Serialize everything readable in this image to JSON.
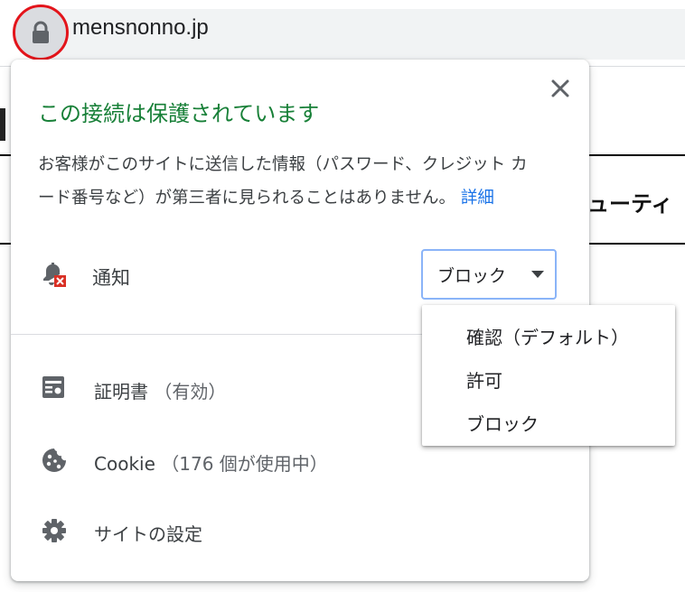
{
  "address_bar": {
    "url": "mensnonno.jp",
    "lock_icon": "lock-icon"
  },
  "background_page": {
    "visible_text": "ューティ"
  },
  "popup": {
    "title": "この接続は保護されています",
    "description_line1": "お客様がこのサイトに送信した情報（パスワード、クレジット カ",
    "description_line2": "ード番号など）が第三者に見られることはありません。",
    "details_link": "詳細",
    "close_icon": "close-icon",
    "notification": {
      "icon": "notification-bell-blocked-icon",
      "label": "通知",
      "selected": "ブロック"
    },
    "items": [
      {
        "icon": "certificate-icon",
        "label": "証明書",
        "sub": "（有効）"
      },
      {
        "icon": "cookie-icon",
        "label": "Cookie",
        "sub": "（176 個が使用中）"
      },
      {
        "icon": "settings-gear-icon",
        "label": "サイトの設定",
        "sub": ""
      }
    ]
  },
  "dropdown": {
    "options": [
      "確認（デフォルト）",
      "許可",
      "ブロック"
    ]
  },
  "colors": {
    "title_green": "#188038",
    "link_blue": "#1a73e8",
    "highlight_red": "#e3141b",
    "focus_blue": "#8ab4f8"
  }
}
